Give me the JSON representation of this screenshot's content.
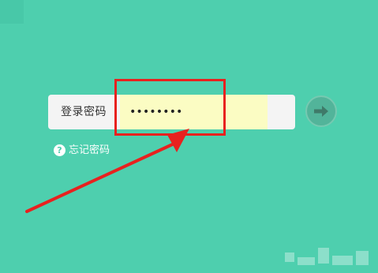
{
  "login": {
    "label": "登录密码",
    "password_value": "••••••••",
    "forgot_label": "忘记密码",
    "help_symbol": "?"
  },
  "icons": {
    "submit": "arrow-right-icon",
    "help": "question-circle-icon"
  },
  "colors": {
    "background": "#4ecfae",
    "input_highlight": "#fbfcc3",
    "annotation": "#e8211f",
    "submit_button": "#52b49a"
  }
}
